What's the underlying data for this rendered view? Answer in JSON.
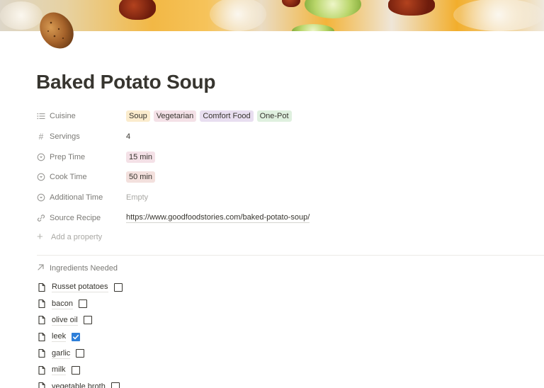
{
  "page": {
    "title": "Baked Potato Soup",
    "icon": "potato-icon"
  },
  "properties": {
    "cuisine": {
      "label": "Cuisine",
      "icon": "list-icon",
      "tags": [
        {
          "text": "Soup",
          "bg": "#fbeccd"
        },
        {
          "text": "Vegetarian",
          "bg": "#f4e1e7"
        },
        {
          "text": "Comfort Food",
          "bg": "#e8def0"
        },
        {
          "text": "One-Pot",
          "bg": "#dff0df"
        }
      ]
    },
    "servings": {
      "label": "Servings",
      "icon": "hash-icon",
      "value": "4"
    },
    "prep_time": {
      "label": "Prep Time",
      "icon": "select-icon",
      "value": "15 min",
      "bg": "#f4e1e7"
    },
    "cook_time": {
      "label": "Cook Time",
      "icon": "select-icon",
      "value": "50 min",
      "bg": "#f3e0dd"
    },
    "additional_time": {
      "label": "Additional Time",
      "icon": "select-icon",
      "value": "Empty"
    },
    "source_recipe": {
      "label": "Source Recipe",
      "icon": "link-icon",
      "value": "https://www.goodfoodstories.com/baked-potato-soup/"
    },
    "add_property": "Add a property"
  },
  "ingredients": {
    "heading": "Ingredients Needed",
    "items": [
      {
        "label": "Russet potatoes",
        "checked": false
      },
      {
        "label": "bacon",
        "checked": false
      },
      {
        "label": "olive oil",
        "checked": false
      },
      {
        "label": "leek",
        "checked": true
      },
      {
        "label": "garlic",
        "checked": false
      },
      {
        "label": "milk",
        "checked": false
      },
      {
        "label": "vegetable broth",
        "checked": false
      }
    ]
  },
  "colors": {
    "text": "#37352f",
    "muted": "#7b7a76",
    "checkbox_checked": "#2e7fd9"
  }
}
